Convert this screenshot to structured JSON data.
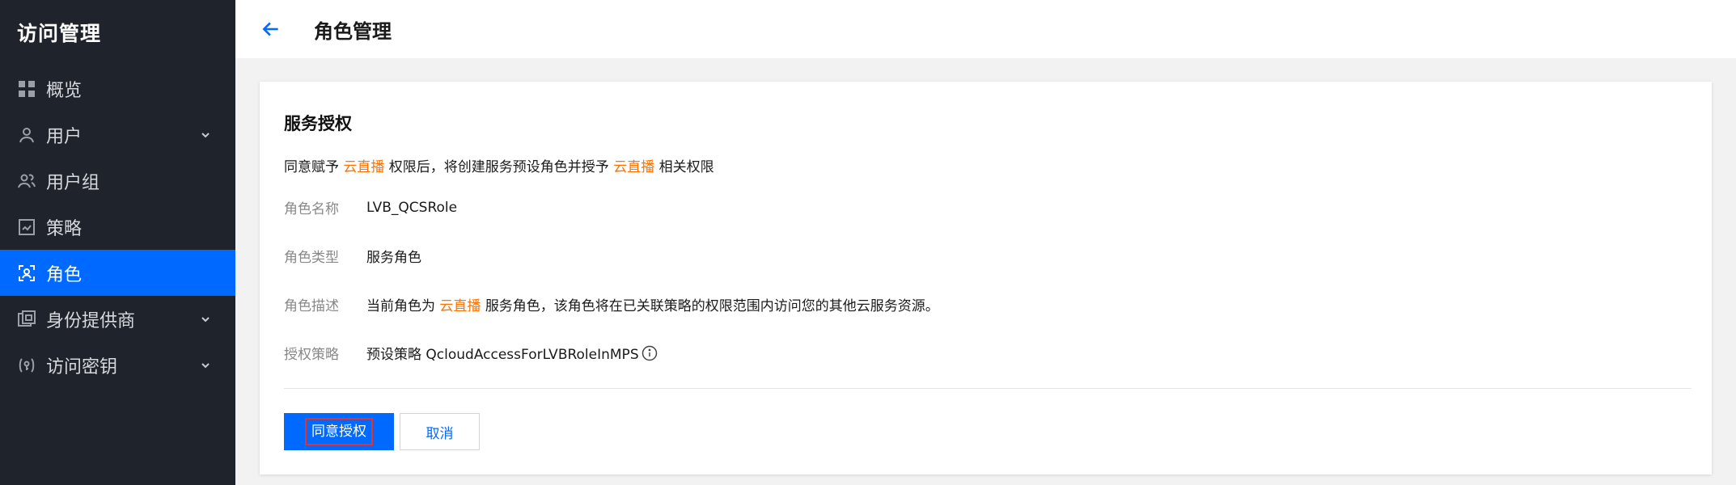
{
  "sidebar": {
    "title": "访问管理",
    "items": [
      {
        "label": "概览",
        "icon": "dashboard-icon",
        "has_chevron": false,
        "active": false
      },
      {
        "label": "用户",
        "icon": "user-icon",
        "has_chevron": true,
        "active": false
      },
      {
        "label": "用户组",
        "icon": "user-group-icon",
        "has_chevron": false,
        "active": false
      },
      {
        "label": "策略",
        "icon": "policy-icon",
        "has_chevron": false,
        "active": false
      },
      {
        "label": "角色",
        "icon": "role-icon",
        "has_chevron": false,
        "active": true
      },
      {
        "label": "身份提供商",
        "icon": "identity-provider-icon",
        "has_chevron": true,
        "active": false
      },
      {
        "label": "访问密钥",
        "icon": "access-key-icon",
        "has_chevron": true,
        "active": false
      }
    ]
  },
  "header": {
    "title": "角色管理",
    "back_icon": "arrow-left-icon"
  },
  "card": {
    "title": "服务授权",
    "desc": {
      "part1": "同意赋予 ",
      "service1": "云直播",
      "part2": " 权限后，将创建服务预设角色并授予 ",
      "service2": "云直播",
      "part3": " 相关权限"
    },
    "fields": {
      "role_name": {
        "label": "角色名称",
        "value": "LVB_QCSRole"
      },
      "role_type": {
        "label": "角色类型",
        "value": "服务角色"
      },
      "role_desc": {
        "label": "角色描述",
        "prefix": "当前角色为 ",
        "service": "云直播",
        "suffix": " 服务角色，该角色将在已关联策略的权限范围内访问您的其他云服务资源。"
      },
      "policy": {
        "label": "授权策略",
        "value": "预设策略 QcloudAccessForLVBRoleInMPS",
        "icon": "info-icon"
      }
    },
    "buttons": {
      "agree": "同意授权",
      "cancel": "取消"
    }
  },
  "colors": {
    "sidebar_bg": "#1f232b",
    "active_bg": "#0069ff",
    "accent": "#0069ff",
    "highlight": "#ff7200"
  }
}
